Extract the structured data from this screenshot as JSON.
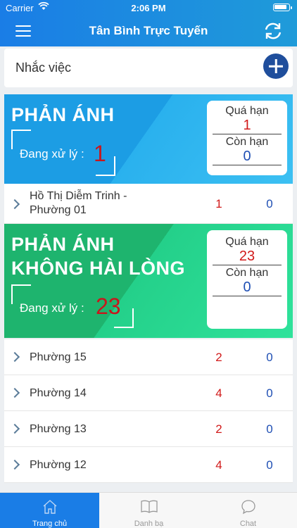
{
  "status": {
    "carrier": "Carrier",
    "time": "2:06 PM"
  },
  "nav": {
    "title": "Tân Bình Trực Tuyến"
  },
  "reminder": {
    "label": "Nhắc việc"
  },
  "card1": {
    "title": "PHẢN ÁNH",
    "processing_label": "Đang xử lý :",
    "processing_value": "1",
    "overdue_label": "Quá hạn",
    "overdue_value": "1",
    "remaining_label": "Còn hạn",
    "remaining_value": "0"
  },
  "card1_rows": [
    {
      "name_line1": "Hồ Thị Diễm Trinh -",
      "name_line2": "Phường 01",
      "overdue": "1",
      "remaining": "0"
    }
  ],
  "card2": {
    "title_line1": "PHẢN ÁNH",
    "title_line2": "KHÔNG HÀI LÒNG",
    "processing_label": "Đang xử lý :",
    "processing_value": "23",
    "overdue_label": "Quá hạn",
    "overdue_value": "23",
    "remaining_label": "Còn hạn",
    "remaining_value": "0"
  },
  "card2_rows": [
    {
      "name": "Phường 15",
      "overdue": "2",
      "remaining": "0"
    },
    {
      "name": "Phường 14",
      "overdue": "4",
      "remaining": "0"
    },
    {
      "name": "Phường 13",
      "overdue": "2",
      "remaining": "0"
    },
    {
      "name": "Phường 12",
      "overdue": "4",
      "remaining": "0"
    }
  ],
  "tabs": [
    {
      "label": "Trang chủ",
      "icon": "home-icon",
      "active": true
    },
    {
      "label": "Danh bạ",
      "icon": "book-icon",
      "active": false
    },
    {
      "label": "Chat",
      "icon": "chat-bubble-icon",
      "active": false
    }
  ],
  "colors": {
    "header": "#1a7de6",
    "card1": "#1c9de4",
    "card2": "#1eb46e",
    "overdue": "#d11a1a",
    "remaining": "#1f4fb4"
  }
}
